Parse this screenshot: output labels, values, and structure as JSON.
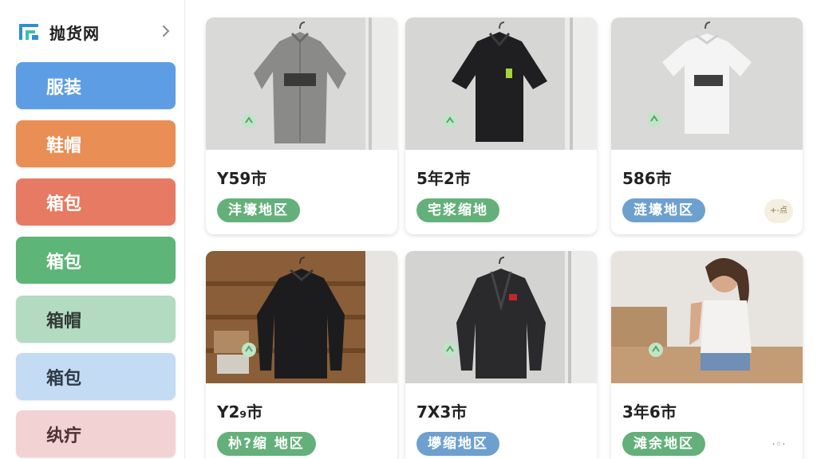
{
  "brand": {
    "name": "抛货网"
  },
  "sidebar": {
    "categories": [
      {
        "label": "服装"
      },
      {
        "label": "鞋帽"
      },
      {
        "label": "箱包"
      },
      {
        "label": "箱包"
      },
      {
        "label": "箱帽"
      },
      {
        "label": "箱包"
      },
      {
        "label": "纨疔"
      }
    ]
  },
  "products": [
    {
      "price": "Y59市",
      "region": "沣壕地区",
      "tag": "",
      "color": "#64b07a"
    },
    {
      "price": "5年2市",
      "region": "宅浆缩地",
      "tag": "",
      "color": "#64b07a"
    },
    {
      "price": "586市",
      "region": "涟壕地区",
      "tag": "+-点",
      "color": "#6ea0cf"
    },
    {
      "price": "Y2₉市",
      "region": "㭂?缩 地区",
      "tag": "",
      "color": "#64b07a"
    },
    {
      "price": "7X3市",
      "region": "㙹缩地区",
      "tag": "",
      "color": "#6ea0cf"
    },
    {
      "price": "3年6市",
      "region": "滩余地区",
      "tag": "·◦·",
      "color": "#64b07a"
    }
  ],
  "icons": {
    "logo": "brand-logo-icon",
    "chevron": "chevron-right-icon"
  }
}
